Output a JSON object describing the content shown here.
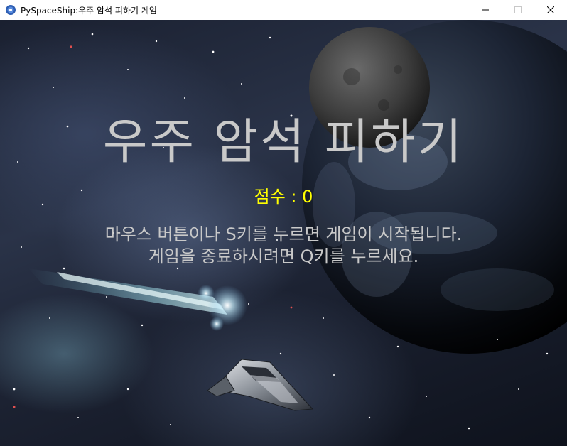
{
  "window": {
    "title": "PySpaceShip:우주 암석 피하기 게임",
    "icon": "python-icon",
    "controls": {
      "minimize": "minimize-icon",
      "maximize": "maximize-icon",
      "close": "close-icon"
    }
  },
  "game": {
    "title": "우주 암석 피하기",
    "score_text": "점수 : 0",
    "score_value": 0,
    "instruction_line1": "마우스 버튼이나 S키를 누르면 게임이 시작됩니다.",
    "instruction_line2": "게임을 종료하시려면 Q키를 누르세요."
  },
  "colors": {
    "title": "#c9c9c9",
    "score": "#ffff00",
    "instructions": "#c9c9c9",
    "titlebar_bg": "#ffffff"
  }
}
